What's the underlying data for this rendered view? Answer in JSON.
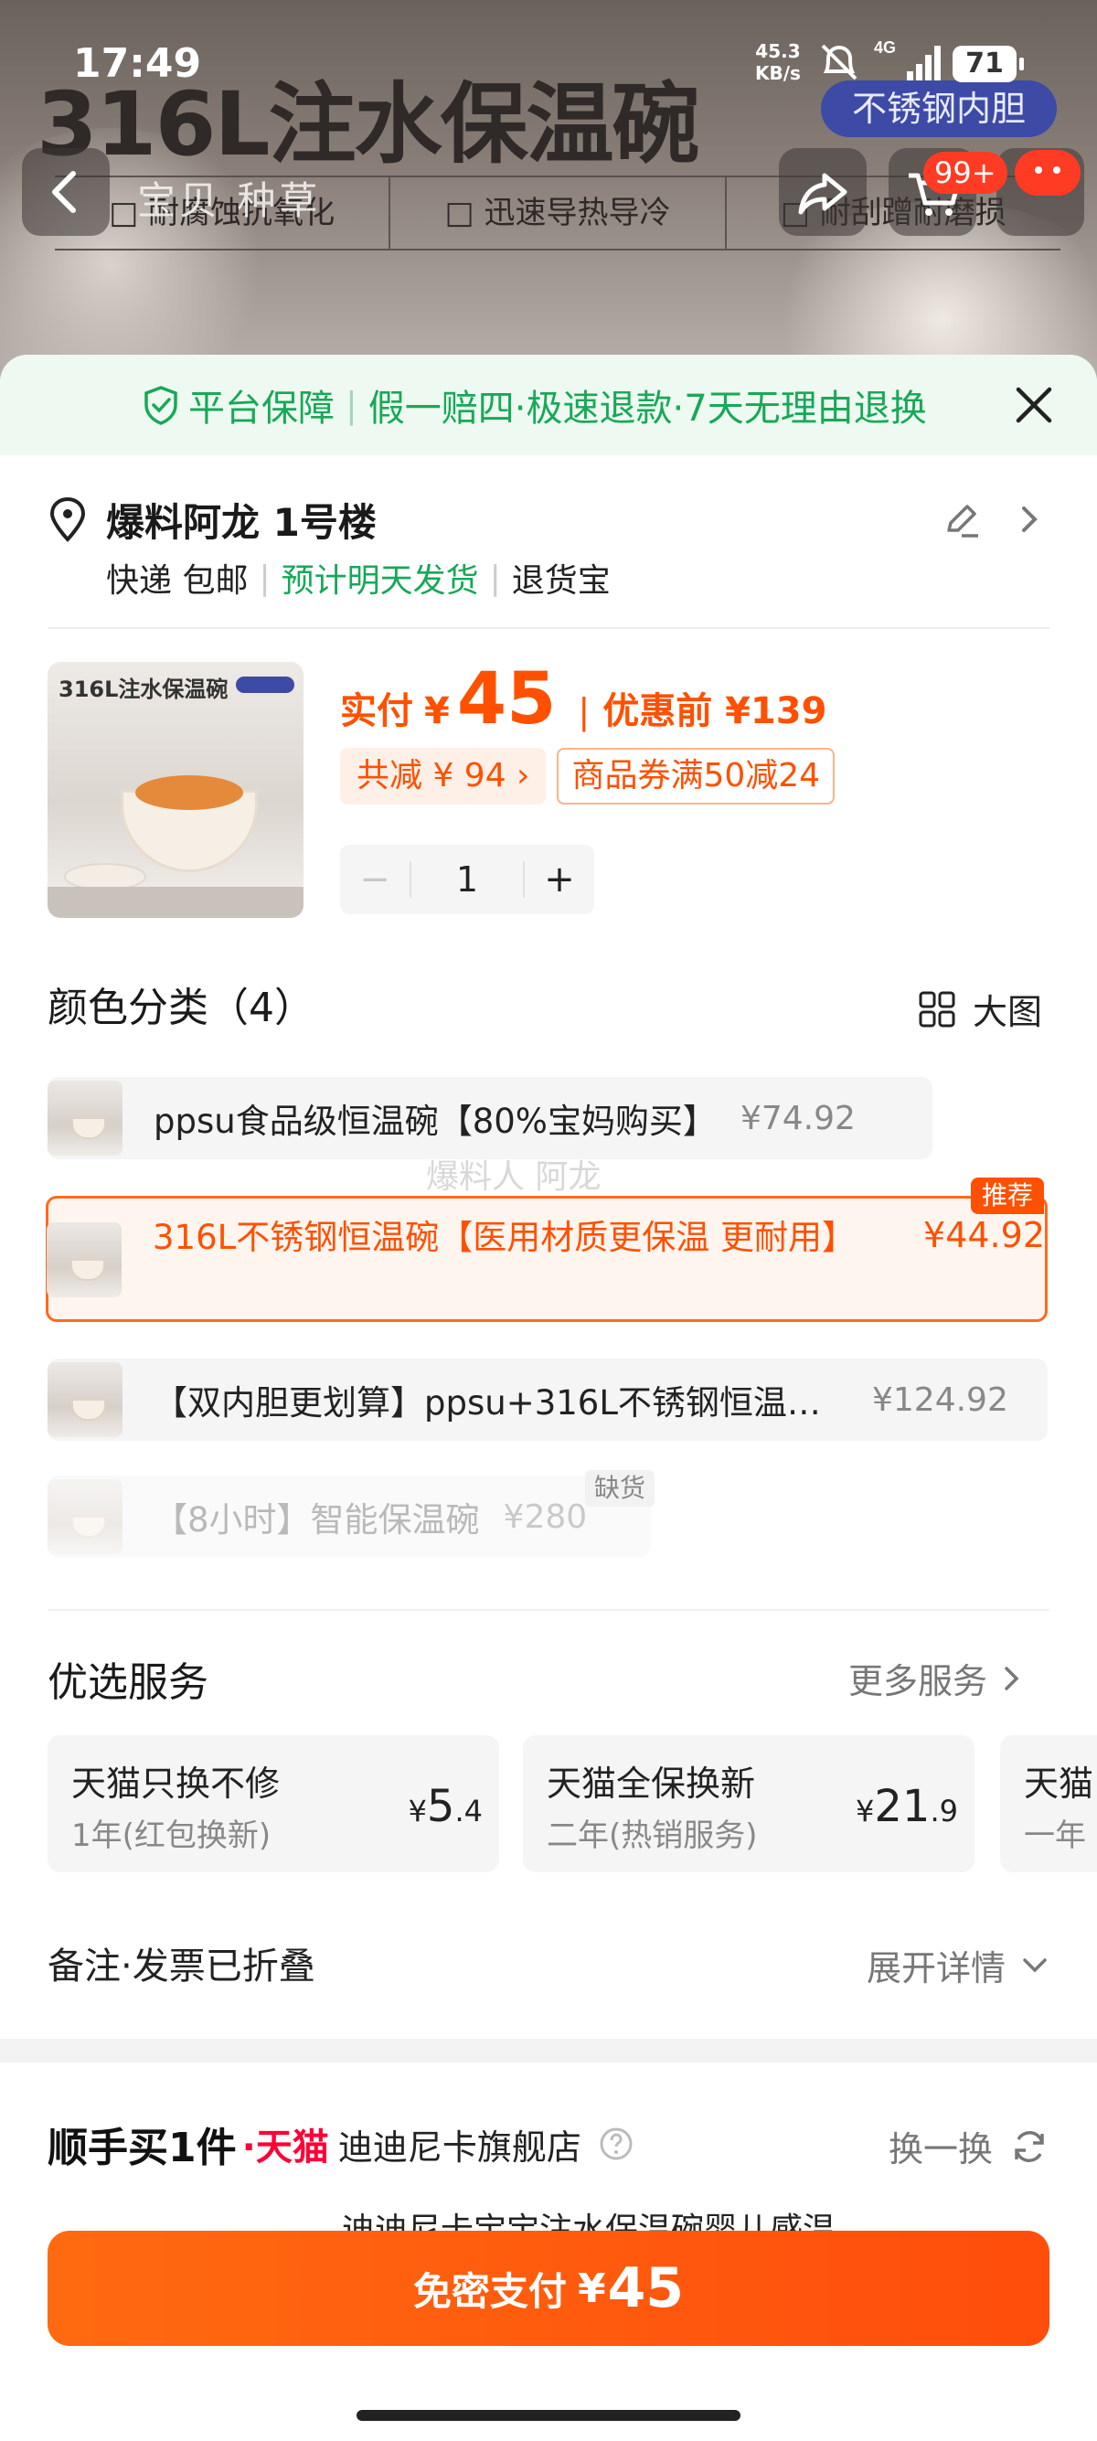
{
  "status_bar": {
    "time": "17:49",
    "net_speed_value": "45.3",
    "net_speed_unit": "KB/s",
    "network": "4G",
    "battery": "71"
  },
  "background": {
    "title": "316L注水保温碗",
    "badge": "不锈钢内胆",
    "tabs": "宝贝  种草",
    "features": [
      "□ 耐腐蚀抗氧化",
      "□ 迅速导热导冷",
      "□ 耐刮蹭耐磨损"
    ],
    "cart_count": "99+"
  },
  "guarantee": {
    "title": "平台保障",
    "separator": "|",
    "desc": "假一赔四·极速退款·7天无理由退换"
  },
  "address": {
    "name": "爆料阿龙 1号楼",
    "shipping": "快递 包邮",
    "eta": "预计明天发货",
    "return": "退货宝",
    "sep": "|"
  },
  "product": {
    "image_title": "316L注水保温碗",
    "pay_label": "实付",
    "currency": "¥",
    "pay_amount": "45",
    "price_sep": "|",
    "original_label": "优惠前 ¥139",
    "total_off": "共减 ¥ 94 ›",
    "coupon": "商品券满50减24",
    "quantity": "1",
    "minus": "−",
    "plus": "+"
  },
  "colors": {
    "title": "颜色分类（4）",
    "big_pic_label": "大图",
    "watermark": "爆料人 阿龙",
    "options": [
      {
        "name": "ppsu食品级恒温碗【80%宝妈购买】",
        "price": "¥74.92"
      },
      {
        "name": "316L不锈钢恒温碗【医用材质更保温 更耐用】",
        "price": "¥44.92",
        "tag": "推荐"
      },
      {
        "name": "【双内胆更划算】ppsu+316L不锈钢恒温…",
        "price": "¥124.92"
      },
      {
        "name": "【8小时】智能保温碗",
        "price": "¥280",
        "tag": "缺货"
      }
    ]
  },
  "services": {
    "title": "优选服务",
    "more": "更多服务",
    "items": [
      {
        "title": "天猫只换不修",
        "sub": "1年(红包换新)",
        "yen": "¥",
        "int": "5",
        "dec": ".4"
      },
      {
        "title": "天猫全保换新",
        "sub": "二年(热销服务)",
        "yen": "¥",
        "int": "21",
        "dec": ".9"
      },
      {
        "title": "天猫",
        "sub": "一年",
        "yen": "",
        "int": "",
        "dec": ""
      }
    ]
  },
  "note": {
    "label": "备注·发票已折叠",
    "expand": "展开详情"
  },
  "addon": {
    "title": "顺手买1件",
    "tmall": "·天猫",
    "store": "迪迪尼卡旗舰店",
    "swap": "换一换",
    "peek": "迪迪尼卡宝宝注水保温碗婴儿感温"
  },
  "pay_button": {
    "label": "免密支付",
    "currency": "¥",
    "amount": "45"
  },
  "colors_theme": {
    "accent": "#ff5000",
    "green": "#18a858"
  }
}
